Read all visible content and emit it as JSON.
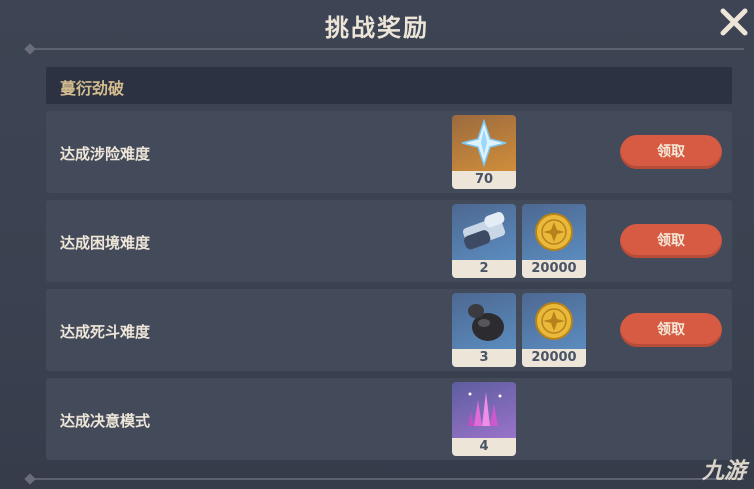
{
  "window": {
    "title": "挑战奖励"
  },
  "section": {
    "title": "蔓衍劲破"
  },
  "rows": [
    {
      "label": "达成涉险难度",
      "items": [
        {
          "icon": "primogem-icon",
          "count": "70"
        }
      ],
      "button": "领取"
    },
    {
      "label": "达成困境难度",
      "items": [
        {
          "icon": "scroll-icon",
          "count": "2"
        },
        {
          "icon": "mora-coin-icon",
          "count": "20000"
        }
      ],
      "button": "领取"
    },
    {
      "label": "达成死斗难度",
      "items": [
        {
          "icon": "gourd-icon",
          "count": "3"
        },
        {
          "icon": "mora-coin-icon",
          "count": "20000"
        }
      ],
      "button": "领取"
    },
    {
      "label": "达成决意模式",
      "items": [
        {
          "icon": "crystal-icon",
          "count": "4"
        }
      ],
      "button": ""
    }
  ],
  "watermark": "九游",
  "colors": {
    "background": "#3a4150",
    "row": "#434a59",
    "header": "#2c3241",
    "button": "#d75a43",
    "text": "#ece5d8",
    "gold_text": "#d3bc8e"
  }
}
